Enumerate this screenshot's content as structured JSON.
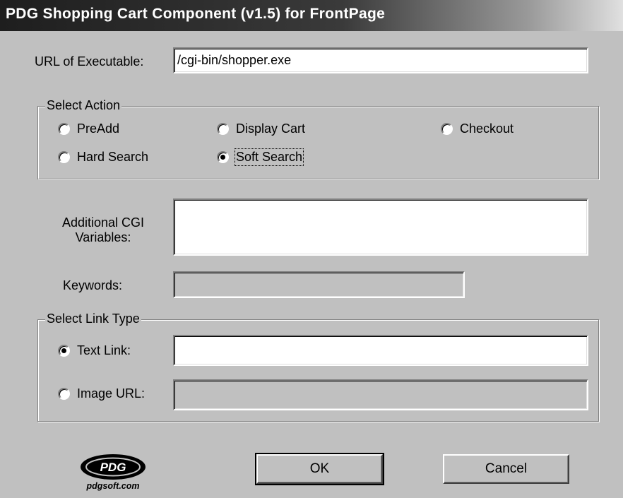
{
  "window": {
    "title": "PDG Shopping Cart Component (v1.5) for FrontPage"
  },
  "url": {
    "label": "URL of Executable:",
    "value": "/cgi-bin/shopper.exe"
  },
  "select_action": {
    "legend": "Select Action",
    "options": [
      {
        "label": "PreAdd",
        "checked": false
      },
      {
        "label": "Display Cart",
        "checked": false
      },
      {
        "label": "Checkout",
        "checked": false
      },
      {
        "label": "Hard Search",
        "checked": false
      },
      {
        "label": "Soft Search",
        "checked": true
      }
    ]
  },
  "cgi_vars": {
    "label": "Additional CGI Variables:",
    "value": ""
  },
  "keywords": {
    "label": "Keywords:",
    "value": ""
  },
  "link_type": {
    "legend": "Select Link Type",
    "text_link": {
      "label": "Text Link:",
      "checked": true,
      "value": ""
    },
    "image_url": {
      "label": "Image URL:",
      "checked": false,
      "value": ""
    }
  },
  "buttons": {
    "ok": "OK",
    "cancel": "Cancel"
  },
  "logo": {
    "mark": "PDG",
    "site": "pdgsoft.com"
  }
}
